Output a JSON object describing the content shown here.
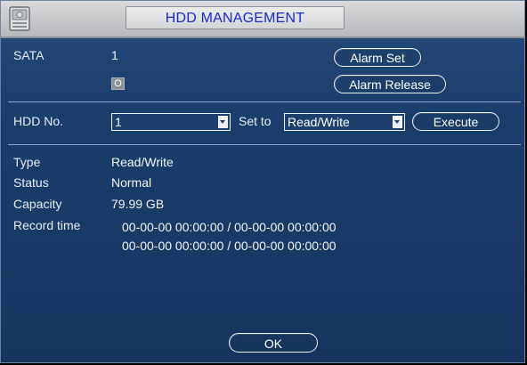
{
  "window": {
    "title": "HDD MANAGEMENT",
    "icon": "hdd-icon"
  },
  "sata": {
    "label": "SATA",
    "number": "1",
    "status_mark": "O"
  },
  "buttons": {
    "alarm_set": "Alarm Set",
    "alarm_release": "Alarm Release",
    "execute": "Execute",
    "ok": "OK"
  },
  "controls": {
    "hdd_no_label": "HDD No.",
    "hdd_no_value": "1",
    "set_to_label": "Set to",
    "set_to_value": "Read/Write"
  },
  "info": {
    "type_label": "Type",
    "type_value": "Read/Write",
    "status_label": "Status",
    "status_value": "Normal",
    "capacity_label": "Capacity",
    "capacity_value": "79.99 GB",
    "record_time_label": "Record time",
    "record_time_1": "00-00-00 00:00:00 / 00-00-00 00:00:00",
    "record_time_2": "00-00-00 00:00:00 / 00-00-00 00:00:00"
  },
  "colors": {
    "background": "#1b3d6c",
    "title_text": "#1a2ad0",
    "title_bar": "#c6c7c9"
  }
}
